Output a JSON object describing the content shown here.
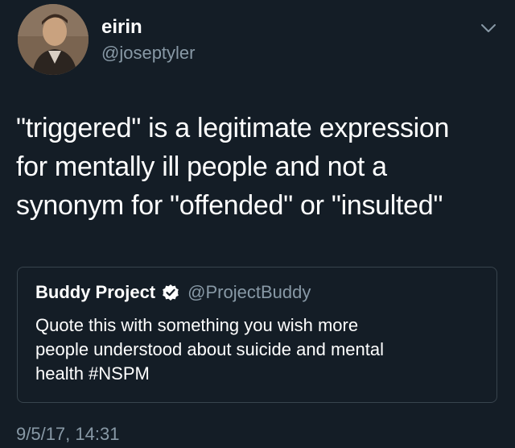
{
  "tweet": {
    "display_name": "eirin",
    "handle": "@joseptyler",
    "text_lines": [
      "\"triggered\" is a legitimate expression",
      "for mentally ill people and not a",
      "synonym for \"offended\" or \"insulted\""
    ],
    "timestamp": "9/5/17, 14:31",
    "menu_icon": "chevron-down-icon"
  },
  "quote": {
    "name": "Buddy Project",
    "verified_icon": "verified-badge-icon",
    "handle": "@ProjectBuddy",
    "text_lines": [
      "Quote this with something you wish more",
      "people understood about suicide and mental",
      "health #NSPM"
    ]
  },
  "colors": {
    "background": "#141d26",
    "primary_text": "#ffffff",
    "secondary_text": "#8899a6",
    "border": "#38444d"
  }
}
